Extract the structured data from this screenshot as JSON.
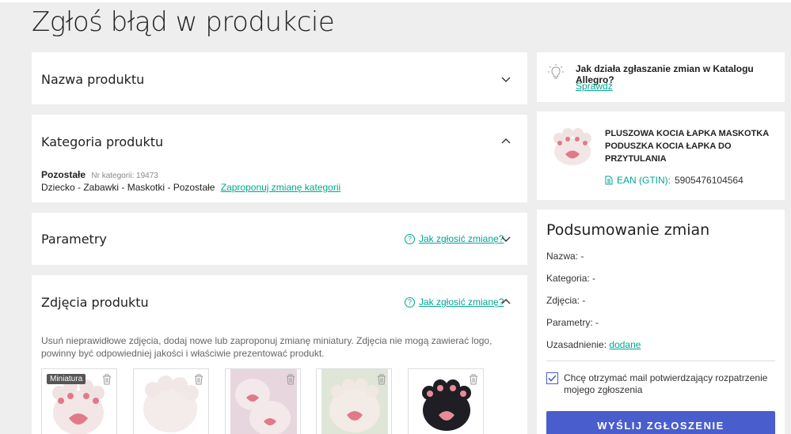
{
  "page": {
    "title": "Zgłoś błąd w produkcie"
  },
  "sections": {
    "name": {
      "title": "Nazwa produktu"
    },
    "category": {
      "title": "Kategoria produktu",
      "current_name": "Pozostałe",
      "category_no": "Nr kategorii: 19473",
      "path": "Dziecko - Zabawki - Maskotki - Pozostałe",
      "change_link": "Zaproponuj zmianę kategorii"
    },
    "params": {
      "title": "Parametry",
      "help_link": "Jak zgłosić zmianę?"
    },
    "photos": {
      "title": "Zdjęcia produktu",
      "help_link": "Jak zgłosić zmianę?",
      "description": "Usuń nieprawidłowe zdjęcia, dodaj nowe lub zaproponuj zmianę miniatury. Zdjęcia nie mogą zawierać logo, powinny być odpowiedniej jakości i właściwie prezentować produkt.",
      "thumbnail_badge": "Miniatura"
    }
  },
  "help_box": {
    "question": "Jak działa zgłaszanie zmian w Katalogu Allegro?",
    "link": "Sprawdź"
  },
  "product": {
    "name_line1": "PLUSZOWA KOCIA ŁAPKA MASKOTKA",
    "name_line2": "PODUSZKA KOCIA ŁAPKA DO",
    "name_line3": "PRZYTULANIA",
    "ean_label": "EAN (GTIN):",
    "ean_value": "5905476104564"
  },
  "summary": {
    "title": "Podsumowanie zmian",
    "name": "Nazwa: -",
    "category": "Kategoria: -",
    "photos": "Zdjęcia: -",
    "params": "Parametry: -",
    "justification_label": "Uzasadnienie:",
    "justification_value": "dodane",
    "checkbox_label_line1": "Chcę otrzymać mail potwierdzający rozpatrzenie",
    "checkbox_label_line2": "mojego zgłoszenia",
    "checkbox_checked": true,
    "submit": "WYŚLIJ ZGŁOSZENIE"
  },
  "colors": {
    "accent": "#00a790",
    "button": "#4a5dcd",
    "background": "#eeeeee"
  }
}
